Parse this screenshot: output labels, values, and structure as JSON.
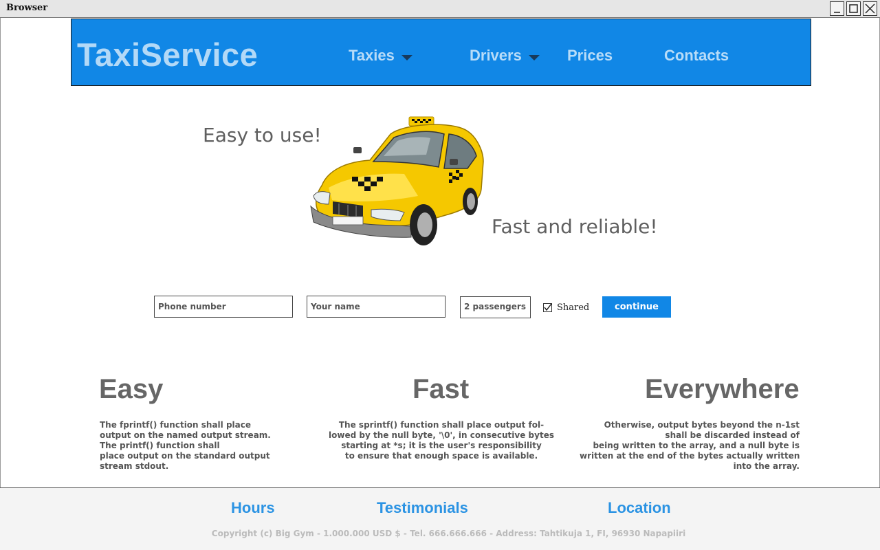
{
  "window": {
    "title": "Browser",
    "buttons": [
      "minimize-icon",
      "maximize-icon",
      "close-icon"
    ]
  },
  "header": {
    "logo": "TaxiService",
    "nav": [
      {
        "label": "Taxies",
        "dropdown": true
      },
      {
        "label": "Drivers",
        "dropdown": true
      },
      {
        "label": "Prices",
        "dropdown": false
      },
      {
        "label": "Contacts",
        "dropdown": false
      }
    ]
  },
  "hero": {
    "tagline_left": "Easy to use!",
    "tagline_right": "Fast and reliable!",
    "image": "taxi-car-icon"
  },
  "booking_form": {
    "phone_placeholder": "Phone number",
    "name_placeholder": "Your name",
    "passengers_value": "2 passengers",
    "shared_label": "Shared",
    "shared_checked": true,
    "continue_label": "continue"
  },
  "features": [
    {
      "title": "Easy",
      "lines": [
        "The  fprintf() function shall place",
        "output on the named output stream.",
        "The printf() function shall",
        "place output on the standard output",
        "stream stdout."
      ]
    },
    {
      "title": "Fast",
      "lines": [
        "The sprintf() function shall place output  fol-",
        "lowed by the null byte, '\\0', in consecutive bytes",
        "starting at *s; it is the user's responsibility",
        "to ensure that enough space is available."
      ]
    },
    {
      "title": "Everywhere",
      "lines": [
        "Otherwise, output bytes beyond the n-1st",
        "shall  be  discarded  instead  of",
        "being  written  to  the array, and a null byte is",
        "written at the end of the bytes actually written",
        "into the array."
      ]
    }
  ],
  "footer": {
    "links": [
      "Hours",
      "Testimonials",
      "Location"
    ],
    "copyright": "Copyright (c) Big Gym - 1.000.000 USD $ - Tel. 666.666.666 - Address: Tahtikuja 1, FI, 96930 Napapiiri"
  },
  "colors": {
    "header_bg": "#1187e6",
    "logo_text": "#b3d9f7",
    "nav_text": "#b8dcf8",
    "button_bg": "#1187e6",
    "footer_link": "#2b93e3",
    "taxi_yellow": "#f5c800"
  }
}
